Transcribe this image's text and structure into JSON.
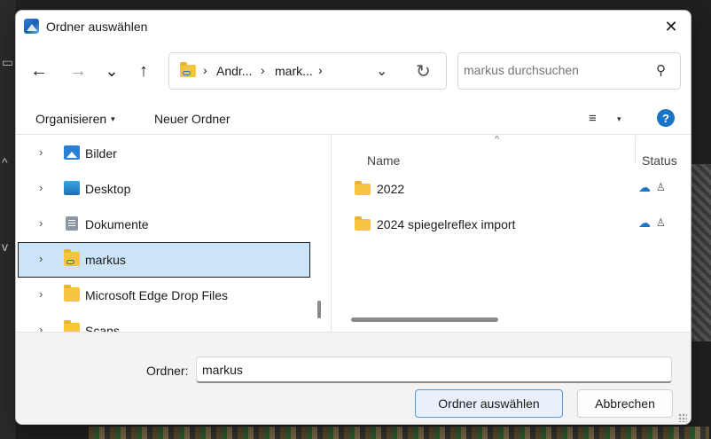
{
  "dialog": {
    "title": "Ordner auswählen",
    "close_glyph": "✕"
  },
  "nav": {
    "back_glyph": "←",
    "forward_glyph": "→",
    "recent_glyph": "⌄",
    "up_glyph": "↑",
    "breadcrumbs": [
      "Andr...",
      "mark..."
    ],
    "sep_glyph": "›",
    "addr_dropdown_glyph": "⌄",
    "refresh_glyph": "↻",
    "search_placeholder": "markus durchsuchen",
    "search_glyph": "⚲"
  },
  "toolbar": {
    "organize_label": "Organisieren",
    "organize_caret": "▾",
    "new_folder_label": "Neuer Ordner",
    "view_glyph": "≡",
    "view_caret": "▾",
    "help_glyph": "?"
  },
  "tree": {
    "chevron_glyph": "›",
    "items": [
      {
        "label": "Bilder",
        "icon": "pictures-icon"
      },
      {
        "label": "Desktop",
        "icon": "desktop-icon"
      },
      {
        "label": "Dokumente",
        "icon": "documents-icon"
      },
      {
        "label": "markus",
        "icon": "folder-icon",
        "selected": true
      },
      {
        "label": "Microsoft Edge Drop Files",
        "icon": "folder-icon"
      },
      {
        "label": "Scans",
        "icon": "folder-icon"
      }
    ]
  },
  "list": {
    "columns": {
      "name": "Name",
      "status": "Status"
    },
    "sort_glyph": "^",
    "cloud_glyph": "☁",
    "person_glyph": "♙",
    "rows": [
      {
        "name": "2022"
      },
      {
        "name": "2024 spiegelreflex import"
      }
    ]
  },
  "footer": {
    "folder_label": "Ordner:",
    "folder_value": "markus",
    "select_button": "Ordner auswählen",
    "cancel_button": "Abbrechen"
  },
  "colors": {
    "accent": "#1a73c7",
    "selection": "#cce4f7",
    "folder": "#f5c542"
  }
}
